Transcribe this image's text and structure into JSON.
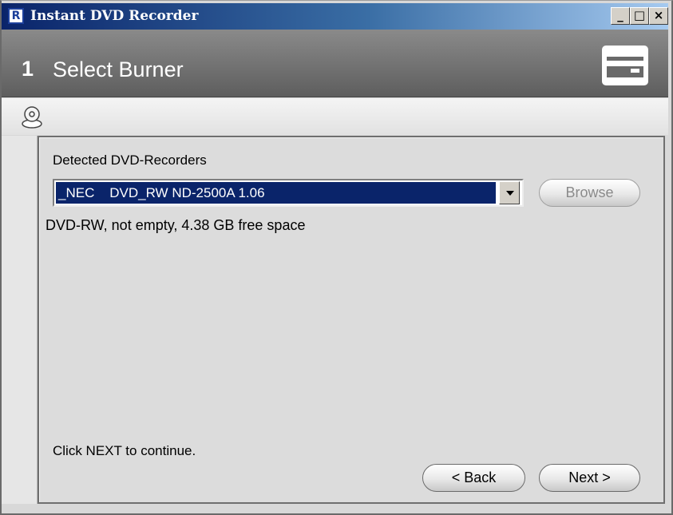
{
  "window": {
    "title": "Instant DVD Recorder",
    "app_icon_letter": "R",
    "minimize_glyph": "_",
    "maximize_glyph": "□",
    "close_glyph": "×"
  },
  "header": {
    "step_number": "1",
    "step_title": "Select Burner",
    "icon": "dvd-burner-icon"
  },
  "toolbar": {
    "icon": "disc-drive-icon"
  },
  "panel": {
    "detected_label": "Detected DVD-Recorders",
    "recorder_select": {
      "value": "_NEC    DVD_RW ND-2500A 1.06"
    },
    "browse_label": "Browse",
    "media_info": "DVD-RW, not empty, 4.38 GB free space",
    "hint": "Click NEXT to continue.",
    "back_label": "< Back",
    "next_label": "Next >"
  },
  "colors": {
    "titlebar_start": "#0a246a",
    "titlebar_end": "#a6caf0",
    "header_gray": "#6e6e6e",
    "selection_blue": "#0a246a",
    "panel_bg": "#dcdcdc"
  }
}
